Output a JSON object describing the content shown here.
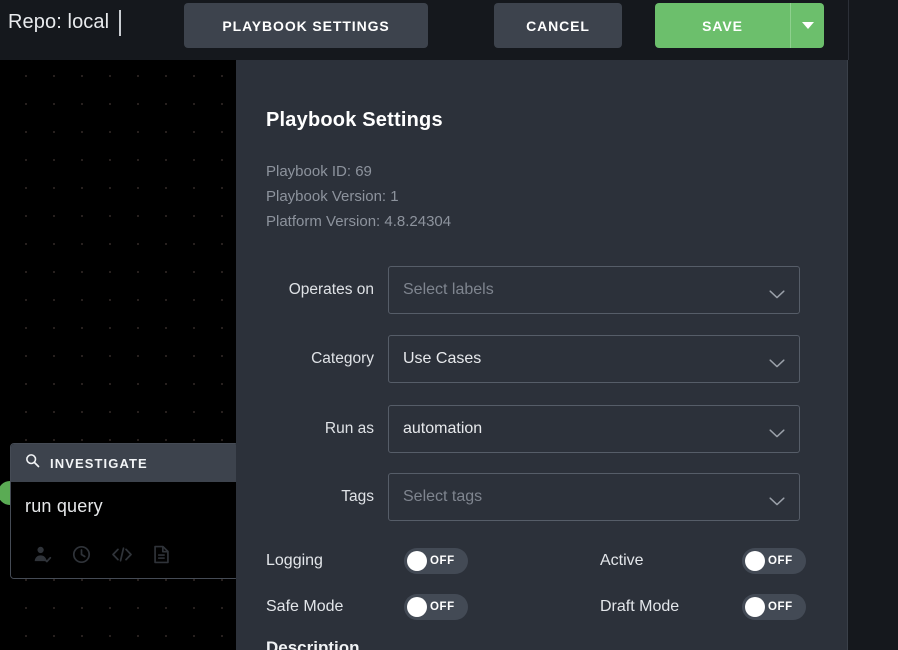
{
  "topbar": {
    "repo_label": "Repo: local",
    "playbook_settings_button": "PLAYBOOK SETTINGS",
    "cancel_button": "CANCEL",
    "save_button": "SAVE",
    "save_caret_icon": "chevron-down-icon",
    "accent_green": "#6cbf6c",
    "button_gray": "#3d434d",
    "bar_background": "#15181d"
  },
  "canvas": {
    "background": "#000000",
    "node": {
      "header_icon": "search-icon",
      "header_title": "INVESTIGATE",
      "title": "run query",
      "port_color": "#5aab54",
      "footer_icons": [
        {
          "name": "user-check-icon"
        },
        {
          "name": "clock-icon"
        },
        {
          "name": "code-icon"
        },
        {
          "name": "document-icon"
        }
      ]
    }
  },
  "panel": {
    "title": "Playbook Settings",
    "meta": {
      "playbook_id": "Playbook ID: 69",
      "playbook_version": "Playbook Version: 1",
      "platform_version": "Platform Version: 4.8.24304"
    },
    "fields": [
      {
        "label": "Operates on",
        "value": "",
        "placeholder": "Select labels",
        "icon": "chevron-down-icon"
      },
      {
        "label": "Category",
        "value": "Use Cases",
        "placeholder": "",
        "icon": "chevron-down-icon"
      },
      {
        "label": "Run as",
        "value": "automation",
        "placeholder": "",
        "icon": "chevron-down-icon"
      },
      {
        "label": "Tags",
        "value": "",
        "placeholder": "Select tags",
        "icon": "chevron-down-icon"
      }
    ],
    "toggles": [
      {
        "label": "Logging",
        "state": "OFF",
        "on": false
      },
      {
        "label": "Active",
        "state": "OFF",
        "on": false
      },
      {
        "label": "Safe Mode",
        "state": "OFF",
        "on": false
      },
      {
        "label": "Draft Mode",
        "state": "OFF",
        "on": false
      }
    ],
    "description_heading": "Description",
    "background": "#2c313a"
  }
}
